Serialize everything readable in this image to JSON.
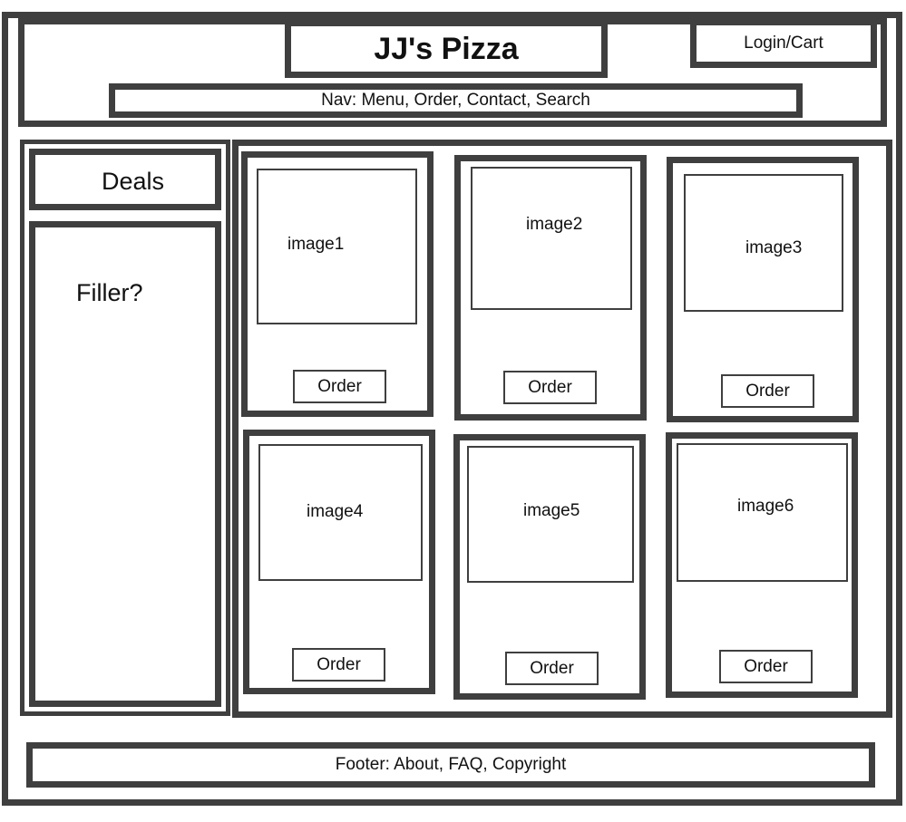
{
  "header": {
    "title": "JJ's Pizza",
    "login_cart": "Login/Cart",
    "nav": "Nav: Menu, Order, Contact, Search"
  },
  "sidebar": {
    "deals": "Deals",
    "filler": "Filler?"
  },
  "products": [
    {
      "image": "image1",
      "button": "Order"
    },
    {
      "image": "image2",
      "button": "Order"
    },
    {
      "image": "image3",
      "button": "Order"
    },
    {
      "image": "image4",
      "button": "Order"
    },
    {
      "image": "image5",
      "button": "Order"
    },
    {
      "image": "image6",
      "button": "Order"
    }
  ],
  "footer": {
    "text": "Footer: About, FAQ, Copyright"
  }
}
